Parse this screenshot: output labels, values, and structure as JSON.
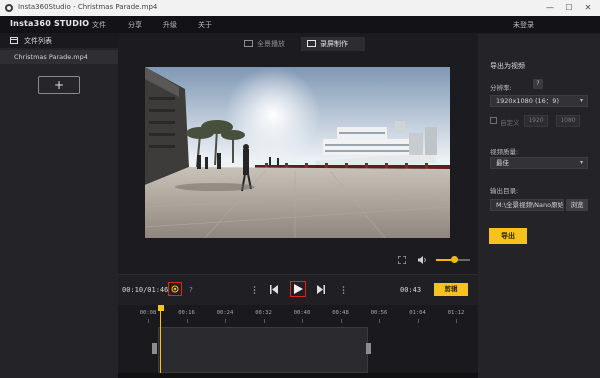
{
  "window": {
    "title": "Insta360Studio - Christmas Parade.mp4",
    "controls": {
      "minimize": "—",
      "maximize": "☐",
      "close": "✕"
    }
  },
  "menubar": {
    "brand": "Insta360 STUDIO",
    "items": [
      "文件",
      "分享",
      "升级",
      "关于"
    ],
    "login": "未登录"
  },
  "sidebar": {
    "header": "文件列表",
    "files": [
      "Christmas Parade.mp4"
    ],
    "add_label": "+"
  },
  "modes": [
    {
      "label": "全景播放",
      "active": false
    },
    {
      "label": "录屏制作",
      "active": true
    }
  ],
  "controls": {
    "current_time": "00:10/01:46",
    "end_time": "00:43",
    "edit_label": "剪辑",
    "help_label": "?",
    "prev_label": "◀",
    "play_label": "▶",
    "next_label": "▶",
    "expand_icon": "expand-icon",
    "volume_icon": "volume-icon",
    "volume_level": 0.55
  },
  "timeline": {
    "ticks": [
      "00:08",
      "00:16",
      "00:24",
      "00:32",
      "00:40",
      "00:48",
      "00:56",
      "01:04",
      "01:12"
    ]
  },
  "export_panel": {
    "title": "导出为视频",
    "resolution_label": "分辨率:",
    "resolution_value": "1920x1080 (16：9)",
    "info_badge": "?",
    "custom_label": "自定义",
    "width_value": "1920",
    "height_value": "1080",
    "quality_label": "视频质量:",
    "quality_value": "最佳",
    "output_label": "输出目录:",
    "output_value": "M:\\全景视频\\Nano原始门",
    "browse_label": "浏览",
    "export_label": "导出"
  },
  "colors": {
    "accent": "#f7c21b",
    "highlight": "#e0241b",
    "background": "#1e1e22"
  }
}
